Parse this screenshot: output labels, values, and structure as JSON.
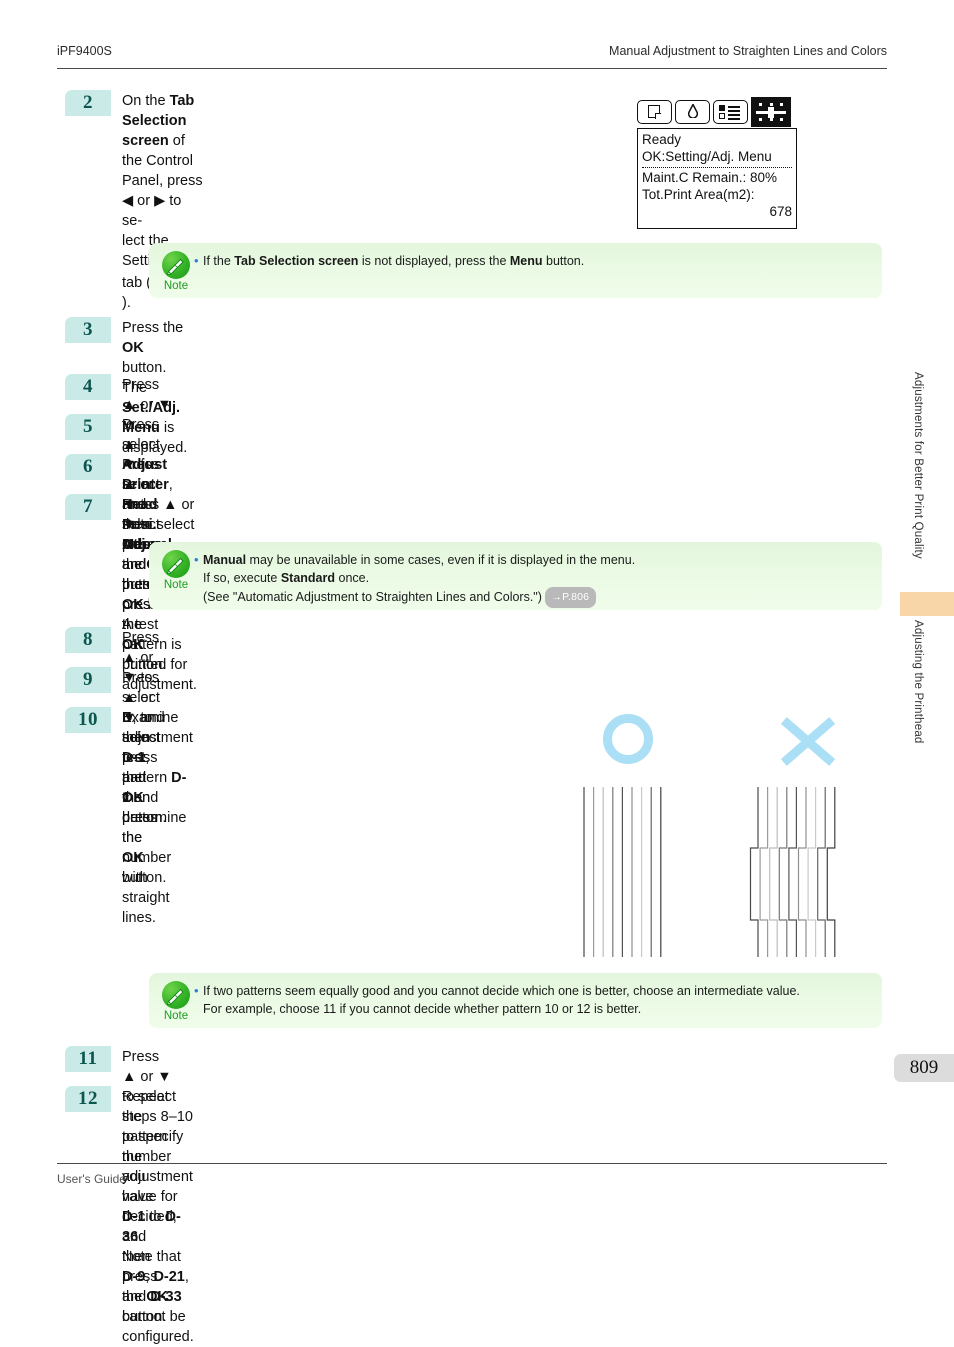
{
  "header": {
    "left": "iPF9400S",
    "right": "Manual Adjustment to Straighten Lines and Colors"
  },
  "footer": {
    "label": "User's Guide",
    "page_number": "809"
  },
  "side_tabs": {
    "chapter": "Adjustments for Better Print Quality",
    "section": "Adjusting the Printhead",
    "marker_color": "#f8d6a7"
  },
  "steps": [
    {
      "number": "2",
      "lines": [
        "On the |Tab Selection screen| of the Control Panel, press ◀ or ▶ to se-",
        "lect the Settings/Adj. tab ( [ICON] )."
      ]
    },
    {
      "number": "3",
      "lines": [
        "Press the |OK| button.",
        "The |Set./Adj. Menu| is displayed."
      ]
    },
    {
      "number": "4",
      "lines": [
        "Press ▲ or ▼ to select |Adjust Printer|, and then press the |OK| button."
      ]
    },
    {
      "number": "5",
      "lines": [
        "Press ▲ or ▼ to select |Head Posi. Adj.|, and then press the |OK| button."
      ]
    },
    {
      "number": "6",
      "lines": [
        "Press ▲ or ▼ to select |Other|, and then press the |OK| button."
      ]
    },
    {
      "number": "7",
      "lines": [
        "Press ▲ or ▼ to select |Manual|, and then press the |OK| button.",
        "A test pattern is printed for adjustment."
      ]
    },
    {
      "number": "8",
      "lines": [
        "Press ▲ or ▼ to select |D|, and then press the |OK| button."
      ]
    },
    {
      "number": "9",
      "lines": [
        "Press ▲ or ▼ to select |D-1|, and then press the |OK| button."
      ]
    },
    {
      "number": "10",
      "lines": [
        "Examine adjustment test pattern |D-1| and determine the number",
        "with straight lines."
      ]
    },
    {
      "number": "11",
      "lines": [
        "Press ▲ or ▼ to select the pattern number you have decided, and then press the |OK| button."
      ]
    },
    {
      "number": "12",
      "lines": [
        "Repeat steps 8–10 to specify the adjustment value for |D-1| to |D-36|.",
        "Note that |D-9|, |D-21|, and |D-33| cannot be configured."
      ]
    }
  ],
  "lcd": {
    "tabs": [
      "paper-tab-icon",
      "ink-tab-icon",
      "job-tab-icon",
      "settings-adj-tab-icon"
    ],
    "selected_tab_index": 3,
    "lines_top": [
      "Ready",
      "OK:Setting/Adj. Menu"
    ],
    "lines_bottom": [
      "Maint.C Remain.: 80%",
      "Tot.Print Area(m2):"
    ],
    "value": "678"
  },
  "notes": [
    {
      "label": "Note",
      "lines": [
        "If the |Tab Selection screen| is not displayed, press the |Menu| button."
      ],
      "page_ref": null
    },
    {
      "label": "Note",
      "lines": [
        "|Manual| may be unavailable in some cases, even if it is displayed in the menu.",
        "If so, execute |Standard| once.",
        "(See \"Automatic Adjustment to Straighten Lines and Colors.\")"
      ],
      "page_ref": "→P.806"
    },
    {
      "label": "Note",
      "lines": [
        "If two patterns seem equally good and you cannot decide which one is better, choose an intermediate value.",
        "For example, choose 11 if you cannot decide whether pattern 10 or 12 is better."
      ],
      "page_ref": null
    }
  ],
  "test_pattern": {
    "good_mark": "circle-mark",
    "bad_mark": "cross-mark",
    "mark_color": "#aadff5",
    "good_lines_count": 9,
    "bad_lines_count": 9,
    "caption": "left pattern lines are straight; right pattern lines are misaligned in the middle band"
  },
  "colors": {
    "step_badge_bg": "#c9eae6",
    "step_badge_fg": "#0d5650",
    "note_bg": "#eafae4",
    "note_icon": "#2eb22a",
    "bullet": "#2f7fd4",
    "page_ref_bg": "#b9b9b9",
    "page_chip_bg": "#dcdcdc"
  }
}
